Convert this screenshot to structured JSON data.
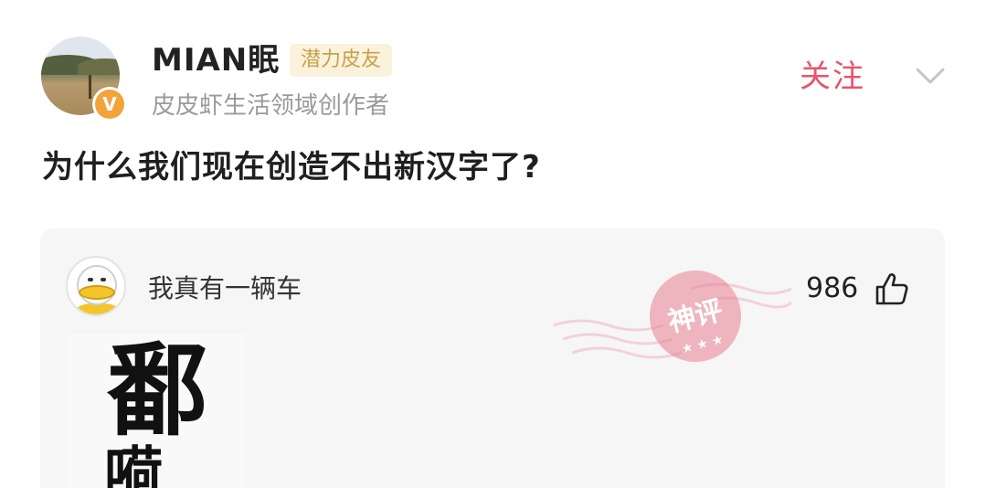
{
  "post": {
    "author": {
      "name": "MIAN眠",
      "badge": "潜力皮友",
      "description": "皮皮虾生活领域创作者",
      "verified_mark": "V"
    },
    "follow_label": "关注",
    "question": "为什么我们现在创造不出新汉字了?"
  },
  "comment": {
    "username": "我真有一辆车",
    "like_count": "986",
    "stamp_text": "神评",
    "image_text": "鄱\n嗬"
  },
  "colors": {
    "follow": "#e8546b",
    "badge_text": "#c8a24c",
    "badge_bg": "#fbf2dc",
    "stamp": "#e0607a"
  },
  "icons": [
    "chevron-down-icon",
    "thumbs-up-icon",
    "verified-icon"
  ]
}
